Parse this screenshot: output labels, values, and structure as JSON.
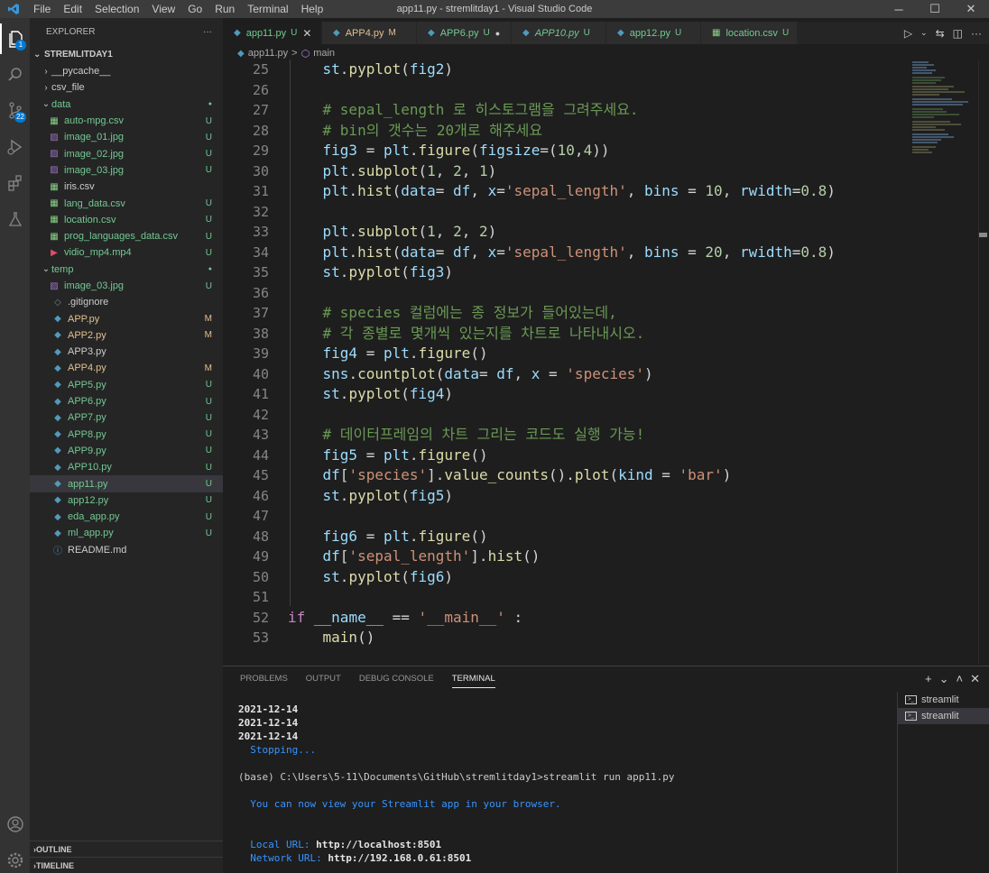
{
  "menu": [
    "File",
    "Edit",
    "Selection",
    "View",
    "Go",
    "Run",
    "Terminal",
    "Help"
  ],
  "window_title": "app11.py - stremlitday1 - Visual Studio Code",
  "window_controls": {
    "minimize": "─",
    "maximize": "☐",
    "close": "✕"
  },
  "activity_badges": {
    "explorer": "1",
    "scm": "22"
  },
  "sidebar": {
    "header": "EXPLORER",
    "more": "···",
    "root": "STREMLITDAY1",
    "items": [
      {
        "label": "__pycache__",
        "indent": 1,
        "chev": "›",
        "icon": "",
        "status": "",
        "color": "#cccccc"
      },
      {
        "label": "csv_file",
        "indent": 1,
        "chev": "›",
        "icon": "",
        "status": "",
        "color": "#cccccc"
      },
      {
        "label": "data",
        "indent": 1,
        "chev": "⌄",
        "icon": "",
        "status": "●",
        "color": "#73c991",
        "scolor": "#73c991"
      },
      {
        "label": "auto-mpg.csv",
        "indent": 2,
        "chev": "",
        "icon": "csv",
        "status": "U",
        "color": "#73c991",
        "scolor": "#73c991"
      },
      {
        "label": "image_01.jpg",
        "indent": 2,
        "chev": "",
        "icon": "img",
        "status": "U",
        "color": "#73c991",
        "scolor": "#73c991"
      },
      {
        "label": "image_02.jpg",
        "indent": 2,
        "chev": "",
        "icon": "img",
        "status": "U",
        "color": "#73c991",
        "scolor": "#73c991"
      },
      {
        "label": "image_03.jpg",
        "indent": 2,
        "chev": "",
        "icon": "img",
        "status": "U",
        "color": "#73c991",
        "scolor": "#73c991"
      },
      {
        "label": "iris.csv",
        "indent": 2,
        "chev": "",
        "icon": "csv",
        "status": "",
        "color": "#cccccc"
      },
      {
        "label": "lang_data.csv",
        "indent": 2,
        "chev": "",
        "icon": "csv",
        "status": "U",
        "color": "#73c991",
        "scolor": "#73c991"
      },
      {
        "label": "location.csv",
        "indent": 2,
        "chev": "",
        "icon": "csv",
        "status": "U",
        "color": "#73c991",
        "scolor": "#73c991"
      },
      {
        "label": "prog_languages_data.csv",
        "indent": 2,
        "chev": "",
        "icon": "csv",
        "status": "U",
        "color": "#73c991",
        "scolor": "#73c991"
      },
      {
        "label": "vidio_mp4.mp4",
        "indent": 2,
        "chev": "",
        "icon": "vid",
        "status": "U",
        "color": "#73c991",
        "scolor": "#73c991"
      },
      {
        "label": "temp",
        "indent": 1,
        "chev": "⌄",
        "icon": "",
        "status": "●",
        "color": "#73c991",
        "scolor": "#73c991"
      },
      {
        "label": "image_03.jpg",
        "indent": 2,
        "chev": "",
        "icon": "img",
        "status": "U",
        "color": "#73c991",
        "scolor": "#73c991"
      },
      {
        "label": ".gitignore",
        "indent": 1,
        "chev": "",
        "icon": "git",
        "status": "",
        "color": "#cccccc"
      },
      {
        "label": "APP.py",
        "indent": 1,
        "chev": "",
        "icon": "py",
        "status": "M",
        "color": "#e2c08d",
        "scolor": "#e2c08d"
      },
      {
        "label": "APP2.py",
        "indent": 1,
        "chev": "",
        "icon": "py",
        "status": "M",
        "color": "#e2c08d",
        "scolor": "#e2c08d"
      },
      {
        "label": "APP3.py",
        "indent": 1,
        "chev": "",
        "icon": "py",
        "status": "",
        "color": "#cccccc"
      },
      {
        "label": "APP4.py",
        "indent": 1,
        "chev": "",
        "icon": "py",
        "status": "M",
        "color": "#e2c08d",
        "scolor": "#e2c08d"
      },
      {
        "label": "APP5.py",
        "indent": 1,
        "chev": "",
        "icon": "py",
        "status": "U",
        "color": "#73c991",
        "scolor": "#73c991"
      },
      {
        "label": "APP6.py",
        "indent": 1,
        "chev": "",
        "icon": "py",
        "status": "U",
        "color": "#73c991",
        "scolor": "#73c991"
      },
      {
        "label": "APP7.py",
        "indent": 1,
        "chev": "",
        "icon": "py",
        "status": "U",
        "color": "#73c991",
        "scolor": "#73c991"
      },
      {
        "label": "APP8.py",
        "indent": 1,
        "chev": "",
        "icon": "py",
        "status": "U",
        "color": "#73c991",
        "scolor": "#73c991"
      },
      {
        "label": "APP9.py",
        "indent": 1,
        "chev": "",
        "icon": "py",
        "status": "U",
        "color": "#73c991",
        "scolor": "#73c991"
      },
      {
        "label": "APP10.py",
        "indent": 1,
        "chev": "",
        "icon": "py",
        "status": "U",
        "color": "#73c991",
        "scolor": "#73c991"
      },
      {
        "label": "app11.py",
        "indent": 1,
        "chev": "",
        "icon": "py",
        "status": "U",
        "color": "#73c991",
        "scolor": "#73c991",
        "selected": true
      },
      {
        "label": "app12.py",
        "indent": 1,
        "chev": "",
        "icon": "py",
        "status": "U",
        "color": "#73c991",
        "scolor": "#73c991"
      },
      {
        "label": "eda_app.py",
        "indent": 1,
        "chev": "",
        "icon": "py",
        "status": "U",
        "color": "#73c991",
        "scolor": "#73c991"
      },
      {
        "label": "ml_app.py",
        "indent": 1,
        "chev": "",
        "icon": "py",
        "status": "U",
        "color": "#73c991",
        "scolor": "#73c991"
      },
      {
        "label": "README.md",
        "indent": 1,
        "chev": "",
        "icon": "info",
        "status": "",
        "color": "#cccccc"
      }
    ],
    "sections": [
      "OUTLINE",
      "TIMELINE"
    ]
  },
  "tabs": [
    {
      "label": "app11.py",
      "status": "U",
      "icon": "py",
      "active": true,
      "close": "✕",
      "color": "#73c991",
      "italic": false
    },
    {
      "label": "APP4.py",
      "status": "M",
      "icon": "py",
      "color": "#e2c08d",
      "italic": false
    },
    {
      "label": "APP6.py",
      "status": "U",
      "icon": "py",
      "color": "#73c991",
      "dot": "●",
      "italic": false
    },
    {
      "label": "APP10.py",
      "status": "U",
      "icon": "py",
      "color": "#73c991",
      "italic": true
    },
    {
      "label": "app12.py",
      "status": "U",
      "icon": "py",
      "color": "#73c991",
      "italic": false
    },
    {
      "label": "location.csv",
      "status": "U",
      "icon": "csv",
      "color": "#73c991",
      "italic": false
    }
  ],
  "breadcrumb": {
    "file": "app11.py",
    "separator": ">",
    "symbol": "main"
  },
  "code": [
    {
      "n": "25",
      "t": [
        [
          "    ",
          "pl"
        ],
        [
          "st",
          "var"
        ],
        [
          ".",
          "pl"
        ],
        [
          "pyplot",
          "fn"
        ],
        [
          "(",
          "pl"
        ],
        [
          "fig2",
          "var"
        ],
        [
          ")",
          "pl"
        ]
      ]
    },
    {
      "n": "26",
      "t": []
    },
    {
      "n": "27",
      "t": [
        [
          "    ",
          "pl"
        ],
        [
          "# sepal_length 로 히스토그램을 그려주세요.",
          "cm"
        ]
      ]
    },
    {
      "n": "28",
      "t": [
        [
          "    ",
          "pl"
        ],
        [
          "# bin의 갯수는 20개로 해주세요",
          "cm"
        ]
      ]
    },
    {
      "n": "29",
      "t": [
        [
          "    ",
          "pl"
        ],
        [
          "fig3",
          "var"
        ],
        [
          " = ",
          "pl"
        ],
        [
          "plt",
          "var"
        ],
        [
          ".",
          "pl"
        ],
        [
          "figure",
          "fn"
        ],
        [
          "(",
          "pl"
        ],
        [
          "figsize",
          "var"
        ],
        [
          "=(",
          "pl"
        ],
        [
          "10",
          "num"
        ],
        [
          ",",
          "pl"
        ],
        [
          "4",
          "num"
        ],
        [
          "))",
          "pl"
        ]
      ]
    },
    {
      "n": "30",
      "t": [
        [
          "    ",
          "pl"
        ],
        [
          "plt",
          "var"
        ],
        [
          ".",
          "pl"
        ],
        [
          "subplot",
          "fn"
        ],
        [
          "(",
          "pl"
        ],
        [
          "1",
          "num"
        ],
        [
          ", ",
          "pl"
        ],
        [
          "2",
          "num"
        ],
        [
          ", ",
          "pl"
        ],
        [
          "1",
          "num"
        ],
        [
          ")",
          "pl"
        ]
      ]
    },
    {
      "n": "31",
      "t": [
        [
          "    ",
          "pl"
        ],
        [
          "plt",
          "var"
        ],
        [
          ".",
          "pl"
        ],
        [
          "hist",
          "fn"
        ],
        [
          "(",
          "pl"
        ],
        [
          "data",
          "var"
        ],
        [
          "= ",
          "pl"
        ],
        [
          "df",
          "var"
        ],
        [
          ", ",
          "pl"
        ],
        [
          "x",
          "var"
        ],
        [
          "=",
          "pl"
        ],
        [
          "'sepal_length'",
          "str"
        ],
        [
          ", ",
          "pl"
        ],
        [
          "bins",
          "var"
        ],
        [
          " = ",
          "pl"
        ],
        [
          "10",
          "num"
        ],
        [
          ", ",
          "pl"
        ],
        [
          "rwidth",
          "var"
        ],
        [
          "=",
          "pl"
        ],
        [
          "0.8",
          "num"
        ],
        [
          ")",
          "pl"
        ]
      ]
    },
    {
      "n": "32",
      "t": []
    },
    {
      "n": "33",
      "t": [
        [
          "    ",
          "pl"
        ],
        [
          "plt",
          "var"
        ],
        [
          ".",
          "pl"
        ],
        [
          "subplot",
          "fn"
        ],
        [
          "(",
          "pl"
        ],
        [
          "1",
          "num"
        ],
        [
          ", ",
          "pl"
        ],
        [
          "2",
          "num"
        ],
        [
          ", ",
          "pl"
        ],
        [
          "2",
          "num"
        ],
        [
          ")",
          "pl"
        ]
      ]
    },
    {
      "n": "34",
      "t": [
        [
          "    ",
          "pl"
        ],
        [
          "plt",
          "var"
        ],
        [
          ".",
          "pl"
        ],
        [
          "hist",
          "fn"
        ],
        [
          "(",
          "pl"
        ],
        [
          "data",
          "var"
        ],
        [
          "= ",
          "pl"
        ],
        [
          "df",
          "var"
        ],
        [
          ", ",
          "pl"
        ],
        [
          "x",
          "var"
        ],
        [
          "=",
          "pl"
        ],
        [
          "'sepal_length'",
          "str"
        ],
        [
          ", ",
          "pl"
        ],
        [
          "bins",
          "var"
        ],
        [
          " = ",
          "pl"
        ],
        [
          "20",
          "num"
        ],
        [
          ", ",
          "pl"
        ],
        [
          "rwidth",
          "var"
        ],
        [
          "=",
          "pl"
        ],
        [
          "0.8",
          "num"
        ],
        [
          ")",
          "pl"
        ]
      ]
    },
    {
      "n": "35",
      "t": [
        [
          "    ",
          "pl"
        ],
        [
          "st",
          "var"
        ],
        [
          ".",
          "pl"
        ],
        [
          "pyplot",
          "fn"
        ],
        [
          "(",
          "pl"
        ],
        [
          "fig3",
          "var"
        ],
        [
          ")",
          "pl"
        ]
      ]
    },
    {
      "n": "36",
      "t": []
    },
    {
      "n": "37",
      "t": [
        [
          "    ",
          "pl"
        ],
        [
          "# species 컬럼에는 종 정보가 들어있는데,",
          "cm"
        ]
      ]
    },
    {
      "n": "38",
      "t": [
        [
          "    ",
          "pl"
        ],
        [
          "# 각 종별로 몇개씩 있는지를 차트로 나타내시오.",
          "cm"
        ]
      ]
    },
    {
      "n": "39",
      "t": [
        [
          "    ",
          "pl"
        ],
        [
          "fig4",
          "var"
        ],
        [
          " = ",
          "pl"
        ],
        [
          "plt",
          "var"
        ],
        [
          ".",
          "pl"
        ],
        [
          "figure",
          "fn"
        ],
        [
          "()",
          "pl"
        ]
      ]
    },
    {
      "n": "40",
      "t": [
        [
          "    ",
          "pl"
        ],
        [
          "sns",
          "var"
        ],
        [
          ".",
          "pl"
        ],
        [
          "countplot",
          "fn"
        ],
        [
          "(",
          "pl"
        ],
        [
          "data",
          "var"
        ],
        [
          "= ",
          "pl"
        ],
        [
          "df",
          "var"
        ],
        [
          ", ",
          "pl"
        ],
        [
          "x",
          "var"
        ],
        [
          " = ",
          "pl"
        ],
        [
          "'species'",
          "str"
        ],
        [
          ")",
          "pl"
        ]
      ]
    },
    {
      "n": "41",
      "t": [
        [
          "    ",
          "pl"
        ],
        [
          "st",
          "var"
        ],
        [
          ".",
          "pl"
        ],
        [
          "pyplot",
          "fn"
        ],
        [
          "(",
          "pl"
        ],
        [
          "fig4",
          "var"
        ],
        [
          ")",
          "pl"
        ]
      ]
    },
    {
      "n": "42",
      "t": []
    },
    {
      "n": "43",
      "t": [
        [
          "    ",
          "pl"
        ],
        [
          "# 데이터프레임의 차트 그리는 코드도 실행 가능!",
          "cm"
        ]
      ]
    },
    {
      "n": "44",
      "t": [
        [
          "    ",
          "pl"
        ],
        [
          "fig5",
          "var"
        ],
        [
          " = ",
          "pl"
        ],
        [
          "plt",
          "var"
        ],
        [
          ".",
          "pl"
        ],
        [
          "figure",
          "fn"
        ],
        [
          "()",
          "pl"
        ]
      ]
    },
    {
      "n": "45",
      "t": [
        [
          "    ",
          "pl"
        ],
        [
          "df",
          "var"
        ],
        [
          "[",
          "pl"
        ],
        [
          "'species'",
          "str"
        ],
        [
          "].",
          "pl"
        ],
        [
          "value_counts",
          "fn"
        ],
        [
          "().",
          "pl"
        ],
        [
          "plot",
          "fn"
        ],
        [
          "(",
          "pl"
        ],
        [
          "kind",
          "var"
        ],
        [
          " = ",
          "pl"
        ],
        [
          "'bar'",
          "str"
        ],
        [
          ")",
          "pl"
        ]
      ]
    },
    {
      "n": "46",
      "t": [
        [
          "    ",
          "pl"
        ],
        [
          "st",
          "var"
        ],
        [
          ".",
          "pl"
        ],
        [
          "pyplot",
          "fn"
        ],
        [
          "(",
          "pl"
        ],
        [
          "fig5",
          "var"
        ],
        [
          ")",
          "pl"
        ]
      ]
    },
    {
      "n": "47",
      "t": []
    },
    {
      "n": "48",
      "t": [
        [
          "    ",
          "pl"
        ],
        [
          "fig6",
          "var"
        ],
        [
          " = ",
          "pl"
        ],
        [
          "plt",
          "var"
        ],
        [
          ".",
          "pl"
        ],
        [
          "figure",
          "fn"
        ],
        [
          "()",
          "pl"
        ]
      ]
    },
    {
      "n": "49",
      "t": [
        [
          "    ",
          "pl"
        ],
        [
          "df",
          "var"
        ],
        [
          "[",
          "pl"
        ],
        [
          "'sepal_length'",
          "str"
        ],
        [
          "].",
          "pl"
        ],
        [
          "hist",
          "fn"
        ],
        [
          "()",
          "pl"
        ]
      ]
    },
    {
      "n": "50",
      "t": [
        [
          "    ",
          "pl"
        ],
        [
          "st",
          "var"
        ],
        [
          ".",
          "pl"
        ],
        [
          "pyplot",
          "fn"
        ],
        [
          "(",
          "pl"
        ],
        [
          "fig6",
          "var"
        ],
        [
          ")",
          "pl"
        ]
      ]
    },
    {
      "n": "51",
      "t": []
    },
    {
      "n": "52",
      "t": [
        [
          "if",
          "kw"
        ],
        [
          " ",
          "pl"
        ],
        [
          "__name__",
          "var"
        ],
        [
          " == ",
          "pl"
        ],
        [
          "'__main__'",
          "str"
        ],
        [
          " :",
          "pl"
        ]
      ]
    },
    {
      "n": "53",
      "t": [
        [
          "    ",
          "pl"
        ],
        [
          "main",
          "fn"
        ],
        [
          "()",
          "pl"
        ]
      ]
    }
  ],
  "panel": {
    "tabs": [
      "PROBLEMS",
      "OUTPUT",
      "DEBUG CONSOLE",
      "TERMINAL"
    ],
    "active_tab": "TERMINAL",
    "actions": [
      "+",
      "⌄",
      "˄",
      "✕"
    ],
    "terminal_lines": [
      {
        "text": "2021-12-14",
        "cls": "bold"
      },
      {
        "text": "2021-12-14",
        "cls": "bold"
      },
      {
        "text": "2021-12-14",
        "cls": "bold"
      },
      {
        "text": "  Stopping...",
        "cls": "cyan"
      },
      {
        "text": "",
        "cls": ""
      },
      {
        "text": "(base) C:\\Users\\5-11\\Documents\\GitHub\\stremlitday1>streamlit run app11.py",
        "cls": ""
      },
      {
        "text": "",
        "cls": ""
      },
      {
        "text": "  You can now view your Streamlit app in your browser.",
        "cls": "cyan"
      },
      {
        "text": "",
        "cls": ""
      },
      {
        "text": "",
        "cls": ""
      },
      {
        "label": "  Local URL: ",
        "value": "http://localhost:8501"
      },
      {
        "label": "  Network URL: ",
        "value": "http://192.168.0.61:8501"
      },
      {
        "text": "",
        "cls": ""
      },
      {
        "text": "",
        "cls": ""
      },
      {
        "cursor": true
      }
    ],
    "terminals": [
      "streamlit",
      "streamlit"
    ]
  }
}
